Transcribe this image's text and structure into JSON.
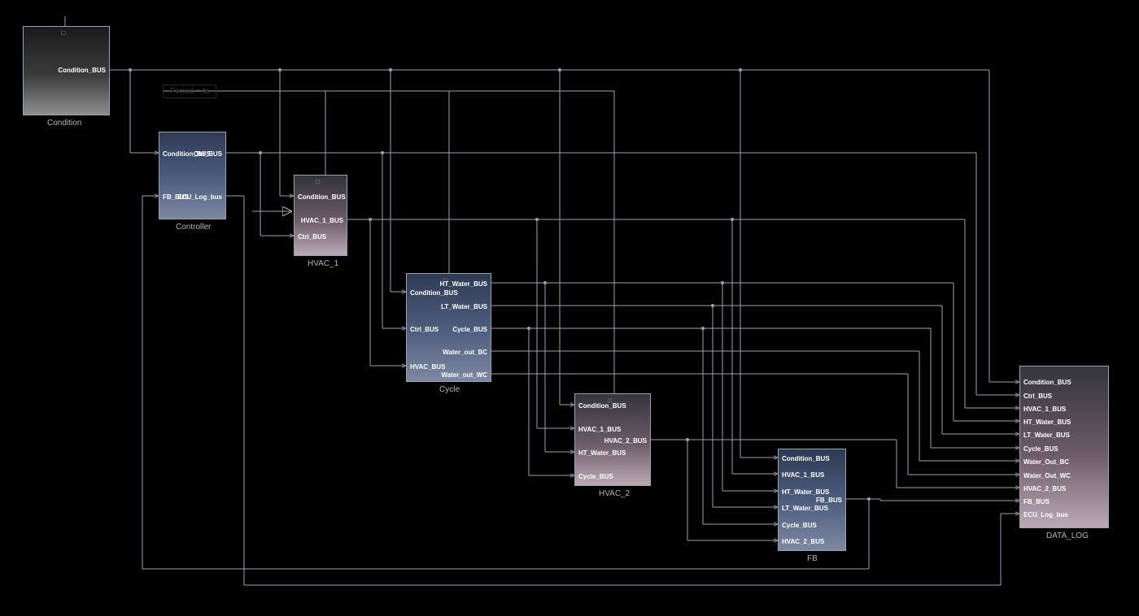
{
  "diagram": {
    "blocks": {
      "condition": {
        "label": "Condition",
        "ports": {
          "out1": "Condition_BUS"
        }
      },
      "controller": {
        "label": "Controller",
        "ports": {
          "in1": "Condition_BUS",
          "in2": "FB_BUS",
          "out1": "Ctrl_BUS",
          "out2": "ECU_Log_bus"
        }
      },
      "hvac1": {
        "label": "HVAC_1",
        "ports": {
          "in1": "Condition_BUS",
          "in2": "Ctrl_BUS",
          "out1": "HVAC_1_BUS"
        }
      },
      "cycle": {
        "label": "Cycle",
        "ports": {
          "in1": "Condition_BUS",
          "in2": "Ctrl_BUS",
          "in3": "HVAC_BUS",
          "out1": "HT_Water_BUS",
          "out2": "LT_Water_BUS",
          "out3": "Cycle_BUS",
          "out4": "Water_out_BC",
          "out5": "Water_out_WC"
        }
      },
      "hvac2": {
        "label": "HVAC_2",
        "ports": {
          "in1": "Condition_BUS",
          "in2": "HVAC_1_BUS",
          "in3": "HT_Water_BUS",
          "in4": "Cycle_BUS",
          "out1": "HVAC_2_BUS"
        }
      },
      "fb": {
        "label": "FB",
        "ports": {
          "in1": "Condition_BUS",
          "in2": "HVAC_1_BUS",
          "in3": "HT_Water_BUS",
          "in4": "LT_Water_BUS",
          "in5": "Cycle_BUS",
          "in6": "HVAC_2_BUS",
          "out1": "FB_BUS"
        }
      },
      "datalog": {
        "label": "DATA_LOG",
        "ports": {
          "in1": "Condition_BUS",
          "in2": "Ctrl_BUS",
          "in3": "HVAC_1_BUS",
          "in4": "HT_Water_BUS",
          "in5": "LT_Water_BUS",
          "in6": "Cycle_BUS",
          "in7": "Water_Out_BC",
          "in8": "Water_Out_WC",
          "in9": "HVAC_2_BUS",
          "in10": "FB_BUS",
          "in11": "ECU_Log_bus"
        }
      }
    },
    "annotation": {
      "period": "Period = ts"
    }
  }
}
